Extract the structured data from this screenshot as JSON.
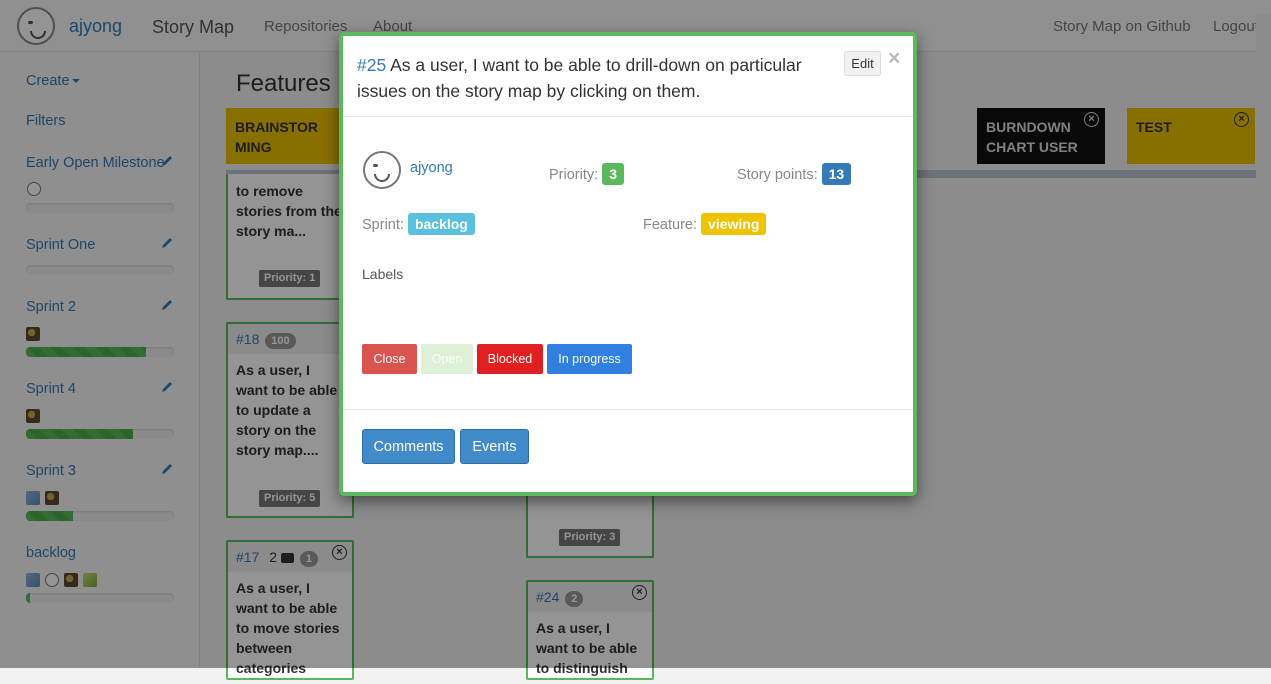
{
  "navbar": {
    "user": "ajyong",
    "brand": "Story Map",
    "links": [
      "Repositories",
      "About"
    ],
    "right_links": [
      "Story Map on Github",
      "Logout"
    ]
  },
  "sidebar": {
    "create_label": "Create",
    "filters_label": "Filters",
    "milestones": [
      {
        "name": "Early Open Milestone",
        "progress": 0
      },
      {
        "name": "Sprint One",
        "progress": 0
      },
      {
        "name": "Sprint 2",
        "progress": 0.81
      },
      {
        "name": "Sprint 4",
        "progress": 0.72
      },
      {
        "name": "Sprint 3",
        "progress": 0.32
      },
      {
        "name": "backlog",
        "progress": 0.03
      }
    ]
  },
  "board": {
    "title": "Features",
    "features": [
      {
        "name": "BRAINSTOR MING",
        "color": "#e8c000"
      },
      {
        "name": "BURNDOWN CHART USER",
        "color": "#111111"
      },
      {
        "name": "TEST",
        "color": "#e8c000"
      }
    ],
    "cards": [
      {
        "text": "to remove stories from the story ma...",
        "priority": "Priority: 1"
      },
      {
        "number": "#18",
        "badge": "100",
        "text": "As a user, I want to be able to update a story on the story map....",
        "priority": "Priority: 5"
      },
      {
        "number": "#17",
        "comments": "2",
        "badge": "1",
        "text": "As a user, I want to be able to move stories between categories"
      },
      {
        "priority": "Priority: 3"
      },
      {
        "number": "#24",
        "badge": "2",
        "text": "As a user, I want to be able to distinguish"
      }
    ]
  },
  "modal": {
    "number": "#25",
    "title": "As a user, I want to be able to drill-down on particular issues on the story map by clicking on them.",
    "edit_label": "Edit",
    "close_glyph": "×",
    "assignee": "ajyong",
    "priority_label": "Priority:",
    "priority_value": "3",
    "story_points_label": "Story points:",
    "story_points_value": "13",
    "sprint_label": "Sprint:",
    "sprint_value": "backlog",
    "feature_label": "Feature:",
    "feature_value": "viewing",
    "labels_heading": "Labels",
    "status_buttons": [
      "Close",
      "Open",
      "Blocked",
      "In progress"
    ],
    "tab_buttons": [
      "Comments",
      "Events"
    ],
    "colors": {
      "border": "#5cb85c",
      "close_btn": "#d9534f",
      "open_btn": "#dff0d8",
      "blocked_btn": "#e02020",
      "in_progress_btn": "#2f80e0"
    }
  }
}
